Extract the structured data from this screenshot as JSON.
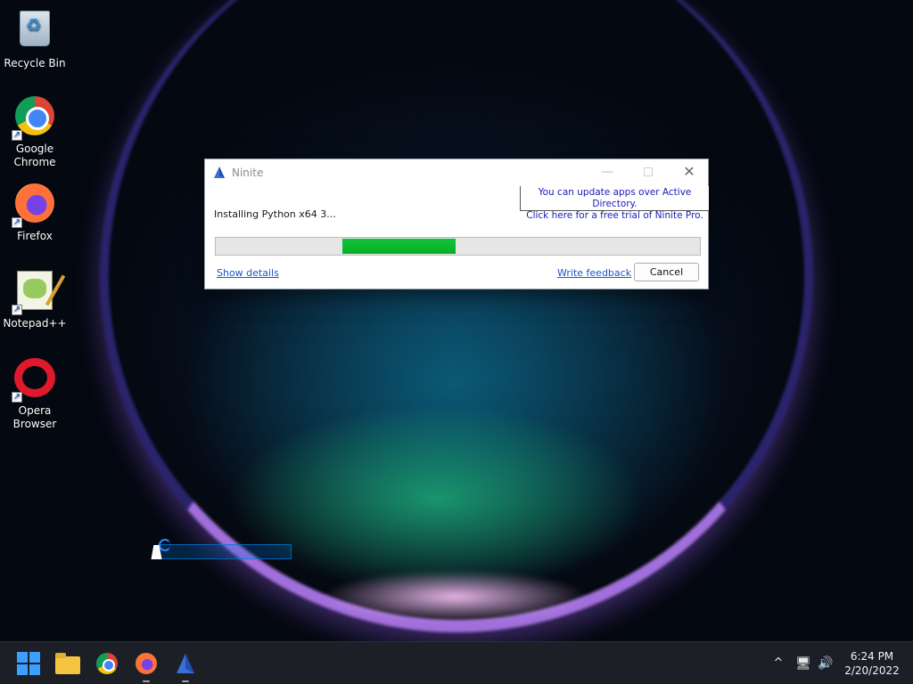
{
  "desktop": {
    "icons": [
      {
        "label": "Recycle Bin",
        "icon": "recycle-bin-icon"
      },
      {
        "label": "Google Chrome",
        "icon": "chrome-icon"
      },
      {
        "label": "Firefox",
        "icon": "firefox-icon"
      },
      {
        "label": "Notepad++",
        "icon": "notepad-plus-plus-icon"
      },
      {
        "label": "Opera Browser",
        "icon": "opera-icon"
      }
    ]
  },
  "ninite": {
    "title": "Ninite",
    "controls": {
      "minimize": "—",
      "close": "✕"
    },
    "tooltip": {
      "line1": "You can update apps over Active Directory.",
      "line2": "Click here for a free trial of Ninite Pro."
    },
    "status_text": "Installing Python x64 3...",
    "progress_color": "#06b025",
    "show_details": "Show details",
    "write_feedback": "Write feedback",
    "cancel": "Cancel"
  },
  "taskbar": {
    "items": [
      "start-icon",
      "file-explorer-icon",
      "chrome-icon",
      "firefox-icon",
      "ninite-icon"
    ],
    "tray": {
      "chevron": "^",
      "network": "🖥",
      "volume": "🔊"
    },
    "time": "6:24 PM",
    "date": "2/20/2022"
  },
  "colors": {
    "accent": "#0078d7",
    "link": "#1a55c8",
    "tooltip_text": "#1a1ab8"
  }
}
